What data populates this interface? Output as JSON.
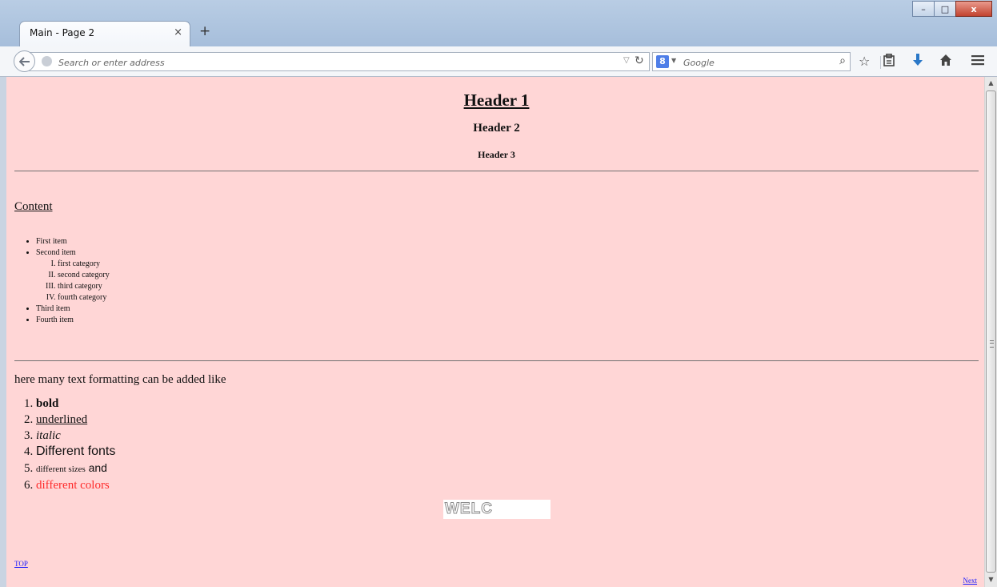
{
  "browser": {
    "tab_title": "Main - Page 2",
    "tab_close": "×",
    "new_tab": "+",
    "window_buttons": {
      "minimize": "–",
      "maximize": "□",
      "close": "x"
    },
    "address_placeholder": "Search or enter address",
    "search_placeholder": "Google",
    "search_engine_badge": "8"
  },
  "page": {
    "header1": "Header 1",
    "header2": "Header 2",
    "header3": "Header 3",
    "content_link": "Content",
    "list": {
      "items": [
        "First item",
        "Second item",
        "Third item",
        "Fourth item"
      ],
      "categories": [
        "first category",
        "second category",
        "third category",
        "fourth category"
      ]
    },
    "intro": "here many text formatting can be added like",
    "formats": {
      "bold": "bold",
      "underlined": "underlined",
      "italic": "italic",
      "fonts": "Different fonts",
      "sizes": "different sizes",
      "and": "and",
      "colors": "different colors"
    },
    "banner": "WELC",
    "top_link": "TOP",
    "next_link": "Next"
  },
  "colors": {
    "page_background": "#ffd6d6",
    "red_text": "#ff2a2a",
    "link": "#1a1aff"
  },
  "icons": [
    "back-icon",
    "globe-icon",
    "reload-icon",
    "search-icon",
    "bookmark-star-icon",
    "reading-list-icon",
    "download-icon",
    "home-icon",
    "menu-icon"
  ]
}
